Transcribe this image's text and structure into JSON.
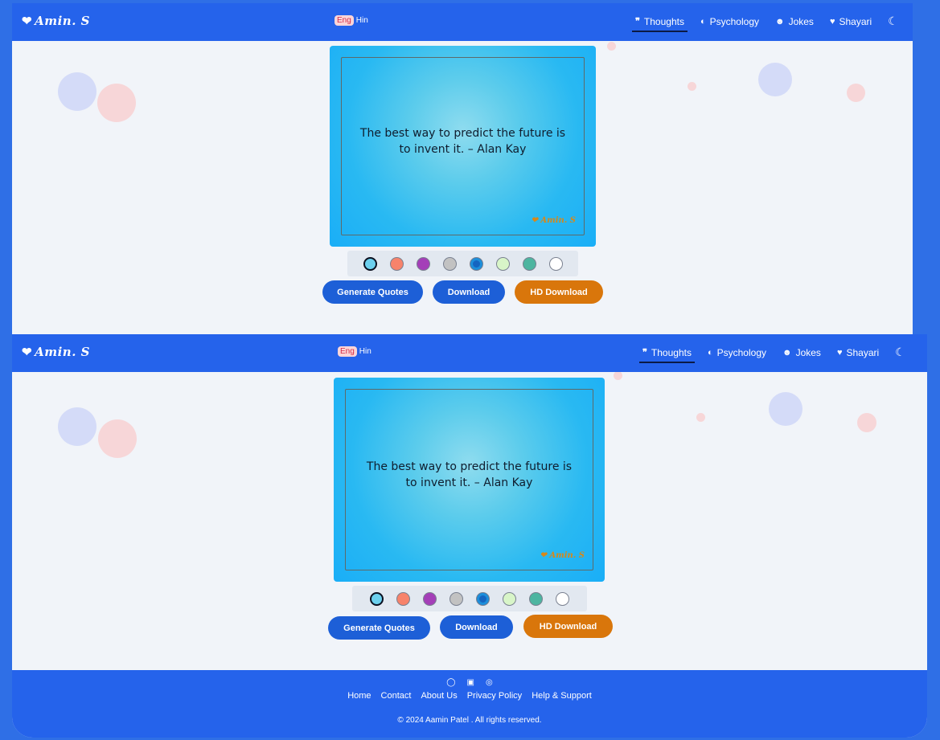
{
  "brand": {
    "logo_text": "Amin. S",
    "logo_glyph": "❤"
  },
  "language": {
    "eng_label": "Eng",
    "hin_label": "Hin"
  },
  "nav": {
    "items": [
      {
        "icon": "❞",
        "label": "Thoughts",
        "active": true
      },
      {
        "icon": "◐",
        "label": "Psychology",
        "active": false
      },
      {
        "icon": "☻",
        "label": "Jokes",
        "active": false
      },
      {
        "icon": "♥",
        "label": "Shayari",
        "active": false
      }
    ],
    "theme_icon": "☾"
  },
  "quote_card": {
    "text": "The best way to predict the future is to invent it. – Alan Kay",
    "watermark": "Amin. S"
  },
  "colors": {
    "swatches": [
      "#6cd0ee",
      "#f7836b",
      "#a43fb8",
      "#c2c2c2",
      "#2196e3",
      "#d8f5c8",
      "#4db5a0",
      "#ffffff"
    ],
    "accent": "#2563eb",
    "hd_button": "#d9760b"
  },
  "buttons": {
    "generate": "Generate Quotes",
    "download": "Download",
    "hd_download": "HD Download"
  },
  "footer": {
    "social_icons": [
      "github-icon",
      "linkedin-icon",
      "instagram-icon"
    ],
    "links": [
      "Home",
      "Contact",
      "About Us",
      "Privacy Policy",
      "Help & Support"
    ],
    "copyright": "© 2024 Aamin Patel . All rights reserved."
  }
}
